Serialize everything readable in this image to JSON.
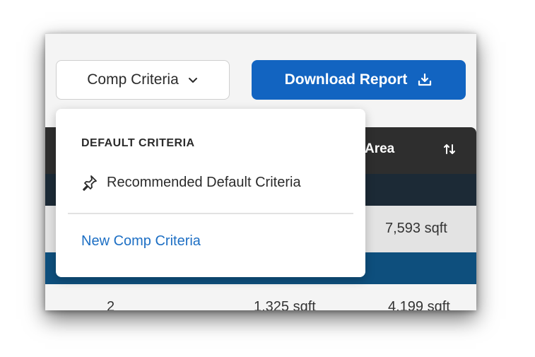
{
  "toolbar": {
    "criteria_label": "Comp Criteria",
    "download_label": "Download Report"
  },
  "table": {
    "header_area": "Area",
    "row1": {
      "area": "7,593 sqft"
    },
    "row2": {
      "col1": "2",
      "col2": "1,325 sqft",
      "area": "4,199 sqft"
    }
  },
  "dropdown": {
    "heading": "DEFAULT CRITERIA",
    "item_label": "Recommended Default Criteria",
    "new_link": "New Comp Criteria"
  },
  "colors": {
    "accent": "#1264c1",
    "header_bg": "#2e2e2e",
    "group_row": "#0e4f7d",
    "link": "#1d6fc4"
  },
  "icons": [
    "chevron-down-icon",
    "download-icon",
    "sort-icon",
    "pin-icon"
  ]
}
